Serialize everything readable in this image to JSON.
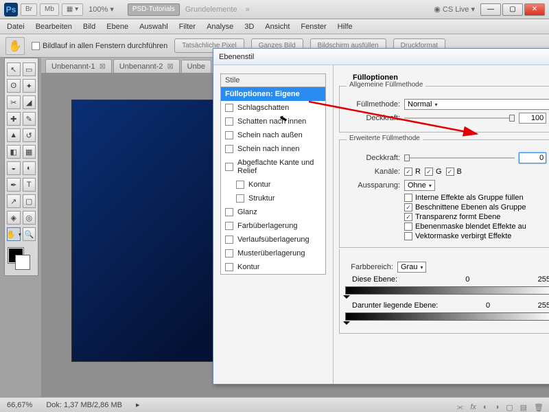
{
  "app": {
    "logo": "Ps",
    "zoom_label": "100%",
    "tag_a": "PSD-Tutorials",
    "tag_b": "Grundelemente",
    "cs_live": "CS Live",
    "br": "Br",
    "mb": "Mb"
  },
  "menu": [
    "Datei",
    "Bearbeiten",
    "Bild",
    "Ebene",
    "Auswahl",
    "Filter",
    "Analyse",
    "3D",
    "Ansicht",
    "Fenster",
    "Hilfe"
  ],
  "optbar": {
    "scroll_all": "Bildlauf in allen Fenstern durchführen",
    "btns": [
      "Tatsächliche Pixel",
      "Ganzes Bild",
      "Bildschirm ausfüllen",
      "Druckformat"
    ]
  },
  "tabs": [
    "Unbenannt-1",
    "Unbenannt-2",
    "Unbe"
  ],
  "status": {
    "zoom": "66,67%",
    "doc": "Dok: 1,37 MB/2,86 MB"
  },
  "dialog": {
    "title": "Ebenenstil",
    "styles_header": "Stile",
    "selected_style": "Fülloptionen: Eigene",
    "styles": [
      "Schlagschatten",
      "Schatten nach innen",
      "Schein nach außen",
      "Schein nach innen",
      "Abgeflachte Kante und Relief"
    ],
    "styles_sub": [
      "Kontur",
      "Struktur"
    ],
    "styles2": [
      "Glanz",
      "Farbüberlagerung",
      "Verlaufsüberlagerung",
      "Musterüberlagerung",
      "Kontur"
    ],
    "right_title": "Fülloptionen",
    "grp1": "Allgemeine Füllmethode",
    "blend_label": "Füllmethode:",
    "blend_value": "Normal",
    "opacity_label": "Deckkraft:",
    "opacity_value": "100",
    "grp2": "Erweiterte Füllmethode",
    "fill_opacity_label": "Deckkraft:",
    "fill_opacity_value": "0",
    "channels_label": "Kanäle:",
    "ch_r": "R",
    "ch_g": "G",
    "ch_b": "B",
    "knockout_label": "Aussparung:",
    "knockout_value": "Ohne",
    "opts": [
      "Interne Effekte als Gruppe füllen",
      "Beschnittene Ebenen als Gruppe",
      "Transparenz formt Ebene",
      "Ebenenmaske blendet Effekte au",
      "Vektormaske verbirgt Effekte"
    ],
    "opts_checked": [
      false,
      true,
      true,
      false,
      false
    ],
    "blendif_label": "Farbbereich:",
    "blendif_value": "Grau",
    "this_layer": "Diese Ebene:",
    "under_layer": "Darunter liegende Ebene:",
    "range_min": "0",
    "range_max": "255"
  }
}
